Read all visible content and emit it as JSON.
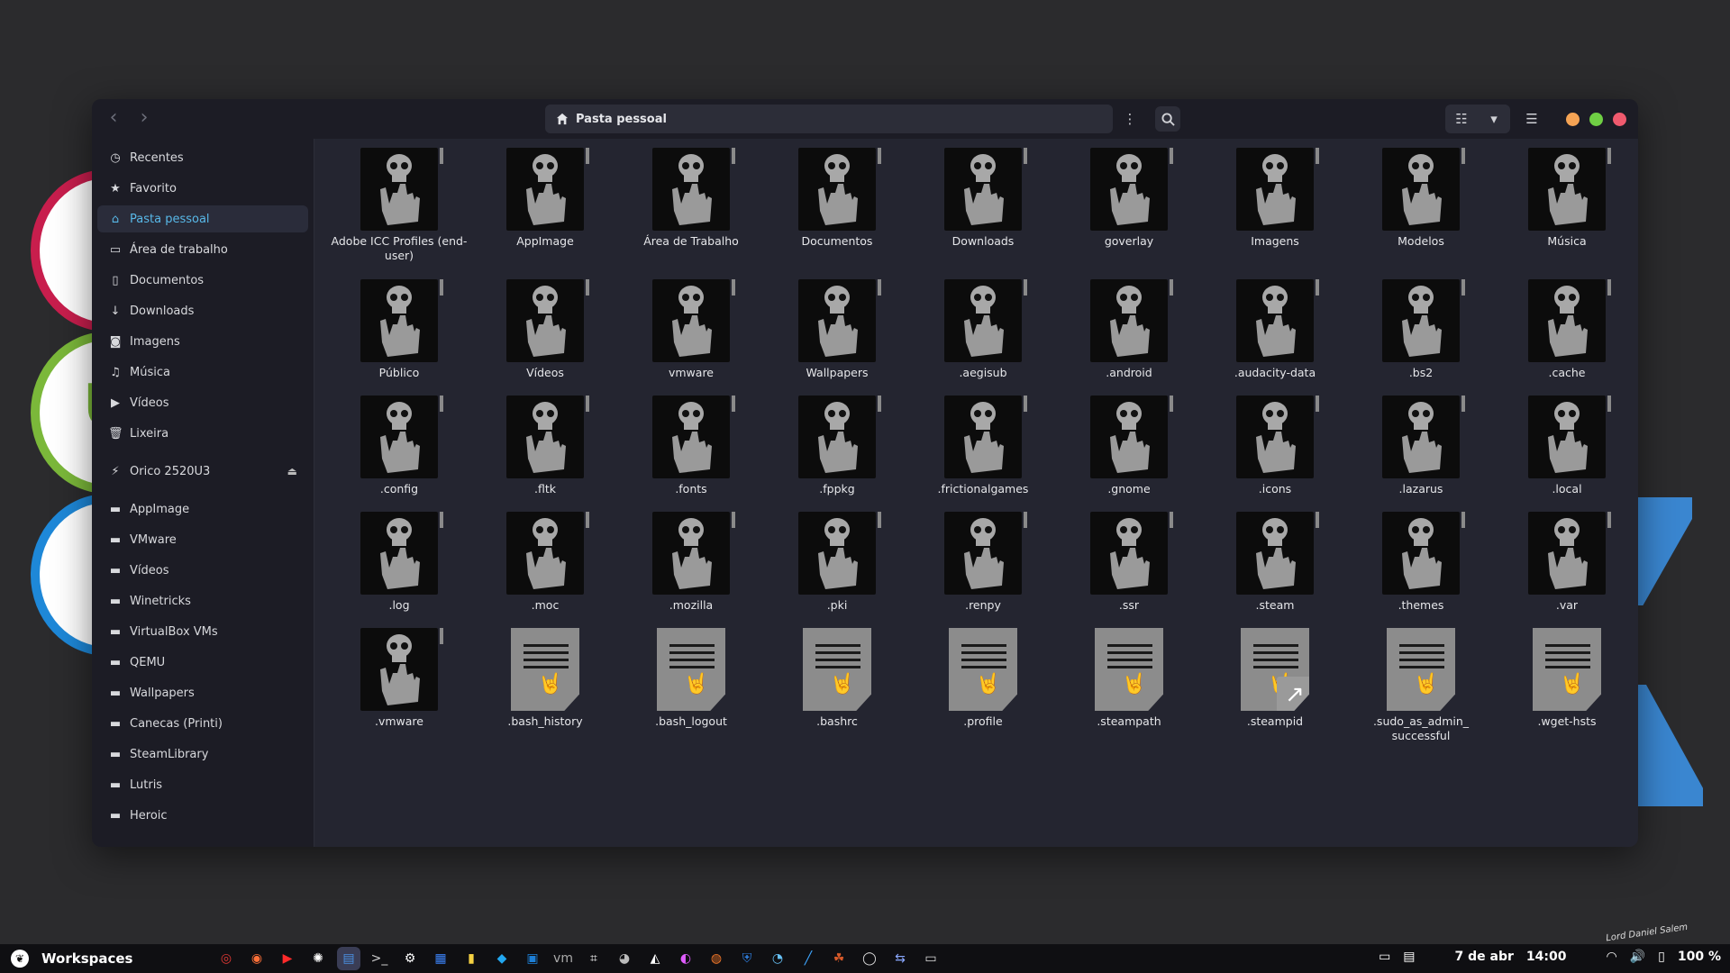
{
  "window": {
    "title": "Pasta pessoal",
    "nav": {
      "back": "‹",
      "forward": "›"
    }
  },
  "sidebar": {
    "places": [
      {
        "label": "Recentes",
        "icon": "clock-icon",
        "glyph": "◷"
      },
      {
        "label": "Favorito",
        "icon": "star-icon",
        "glyph": "★"
      },
      {
        "label": "Pasta pessoal",
        "icon": "home-icon",
        "glyph": "⌂",
        "active": true
      },
      {
        "label": "Área de trabalho",
        "icon": "folder-icon",
        "glyph": "▭"
      },
      {
        "label": "Documentos",
        "icon": "document-icon",
        "glyph": "▯"
      },
      {
        "label": "Downloads",
        "icon": "download-icon",
        "glyph": "↓"
      },
      {
        "label": "Imagens",
        "icon": "camera-icon",
        "glyph": "◙"
      },
      {
        "label": "Música",
        "icon": "music-icon",
        "glyph": "♫"
      },
      {
        "label": "Vídeos",
        "icon": "video-icon",
        "glyph": "▶"
      },
      {
        "label": "Lixeira",
        "icon": "trash-icon",
        "glyph": "🗑"
      }
    ],
    "devices": [
      {
        "label": "Orico 2520U3",
        "icon": "usb-icon",
        "glyph": "⚡"
      }
    ],
    "bookmarks": [
      "AppImage",
      "VMware",
      "Vídeos",
      "Winetricks",
      "VirtualBox VMs",
      "QEMU",
      "Wallpapers",
      "Canecas (Printi)",
      "SteamLibrary",
      "Lutris",
      "Heroic"
    ]
  },
  "files": [
    {
      "name": "Adobe ICC Profiles (end-user)",
      "type": "folder"
    },
    {
      "name": "AppImage",
      "type": "folder"
    },
    {
      "name": "Área de Trabalho",
      "type": "folder"
    },
    {
      "name": "Documentos",
      "type": "folder"
    },
    {
      "name": "Downloads",
      "type": "folder"
    },
    {
      "name": "goverlay",
      "type": "folder"
    },
    {
      "name": "Imagens",
      "type": "folder"
    },
    {
      "name": "Modelos",
      "type": "folder"
    },
    {
      "name": "Música",
      "type": "folder"
    },
    {
      "name": "Público",
      "type": "folder"
    },
    {
      "name": "Vídeos",
      "type": "folder"
    },
    {
      "name": "vmware",
      "type": "folder"
    },
    {
      "name": "Wallpapers",
      "type": "folder"
    },
    {
      "name": ".aegisub",
      "type": "folder"
    },
    {
      "name": ".android",
      "type": "folder"
    },
    {
      "name": ".audacity-data",
      "type": "folder"
    },
    {
      "name": ".bs2",
      "type": "folder"
    },
    {
      "name": ".cache",
      "type": "folder"
    },
    {
      "name": ".config",
      "type": "folder"
    },
    {
      "name": ".fltk",
      "type": "folder"
    },
    {
      "name": ".fonts",
      "type": "folder"
    },
    {
      "name": ".fppkg",
      "type": "folder"
    },
    {
      "name": ".frictionalgames",
      "type": "folder"
    },
    {
      "name": ".gnome",
      "type": "folder"
    },
    {
      "name": ".icons",
      "type": "folder"
    },
    {
      "name": ".lazarus",
      "type": "folder"
    },
    {
      "name": ".local",
      "type": "folder"
    },
    {
      "name": ".log",
      "type": "folder"
    },
    {
      "name": ".moc",
      "type": "folder"
    },
    {
      "name": ".mozilla",
      "type": "folder"
    },
    {
      "name": ".pki",
      "type": "folder"
    },
    {
      "name": ".renpy",
      "type": "folder"
    },
    {
      "name": ".ssr",
      "type": "folder"
    },
    {
      "name": ".steam",
      "type": "folder"
    },
    {
      "name": ".themes",
      "type": "folder"
    },
    {
      "name": ".var",
      "type": "folder"
    },
    {
      "name": ".vmware",
      "type": "folder"
    },
    {
      "name": ".bash_history",
      "type": "file"
    },
    {
      "name": ".bash_logout",
      "type": "file"
    },
    {
      "name": ".bashrc",
      "type": "file"
    },
    {
      "name": ".profile",
      "type": "file"
    },
    {
      "name": ".steampath",
      "type": "file"
    },
    {
      "name": ".steampid",
      "type": "link"
    },
    {
      "name": ".sudo_as_admin_ successful",
      "type": "file"
    },
    {
      "name": ".wget-hsts",
      "type": "file"
    }
  ],
  "taskbar": {
    "workspaces_label": "Workspaces",
    "date": "7 de abr",
    "time": "14:00",
    "battery": "100 %",
    "apps": [
      {
        "icon": "chrome-icon",
        "glyph": "◎",
        "color": "#e53935"
      },
      {
        "icon": "firefox-icon",
        "glyph": "◉",
        "color": "#ff7139"
      },
      {
        "icon": "youtube-music-icon",
        "glyph": "▶",
        "color": "#ff2a2a"
      },
      {
        "icon": "chatgpt-icon",
        "glyph": "✺",
        "color": "#ffffff"
      },
      {
        "icon": "files-icon",
        "glyph": "▤",
        "color": "#4a90e2"
      },
      {
        "icon": "terminal-icon",
        "glyph": ">_",
        "color": "#cccccc"
      },
      {
        "icon": "settings-icon",
        "glyph": "⚙",
        "color": "#ffffff"
      },
      {
        "icon": "writer-icon",
        "glyph": "▦",
        "color": "#3b82f6"
      },
      {
        "icon": "notes-icon",
        "glyph": "▮",
        "color": "#f5d142"
      },
      {
        "icon": "vscode-icon",
        "glyph": "◆",
        "color": "#22a7f0"
      },
      {
        "icon": "virtualbox-icon",
        "glyph": "▣",
        "color": "#1d7fd6"
      },
      {
        "icon": "vmware-icon",
        "glyph": "vm",
        "color": "#aaaaaa"
      },
      {
        "icon": "screenshot-icon",
        "glyph": "⌗",
        "color": "#ffffff"
      },
      {
        "icon": "gimp-icon",
        "glyph": "◕",
        "color": "#bbbbbb"
      },
      {
        "icon": "inkscape-icon",
        "glyph": "◭",
        "color": "#ffffff"
      },
      {
        "icon": "color-picker-icon",
        "glyph": "◐",
        "color": "#e05cff"
      },
      {
        "icon": "blender-icon",
        "glyph": "◍",
        "color": "#f5792a"
      },
      {
        "icon": "bitwarden-icon",
        "glyph": "⛨",
        "color": "#2f7fe0"
      },
      {
        "icon": "steam-icon",
        "glyph": "◔",
        "color": "#66c0f4"
      },
      {
        "icon": "pen-icon",
        "glyph": "╱",
        "color": "#3ea6ff"
      },
      {
        "icon": "game-icon",
        "glyph": "☘",
        "color": "#d85a2a"
      },
      {
        "icon": "obs-icon",
        "glyph": "◯",
        "color": "#dddddd"
      },
      {
        "icon": "transfer-icon",
        "glyph": "⇆",
        "color": "#8aa8ff"
      },
      {
        "icon": "folder-icon",
        "glyph": "▭",
        "color": "#dddddd"
      }
    ]
  },
  "signature": "Lord Daniel Salem"
}
